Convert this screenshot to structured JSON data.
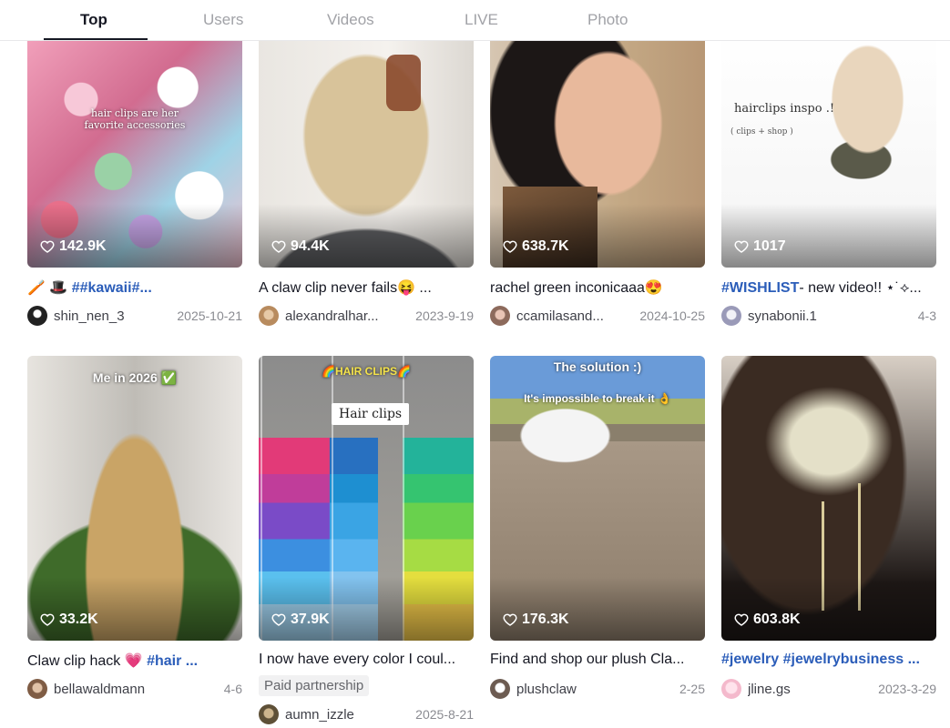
{
  "tabs": [
    "Top",
    "Users",
    "Videos",
    "LIVE",
    "Photo"
  ],
  "active_tab": "Top",
  "videos": [
    {
      "likes": "142.9K",
      "overlay": "hair clips are her favorite accessories",
      "caption_prefix": "🪥 🎩 ",
      "caption_tag": "##kawaii#...",
      "caption_text": "",
      "username": "shin_nen_3",
      "date": "2025-10-21"
    },
    {
      "likes": "94.4K",
      "caption_prefix": "",
      "caption_tag": "",
      "caption_text": "A claw clip never fails😝 ...",
      "username": "alexandralhar...",
      "date": "2023-9-19"
    },
    {
      "likes": "638.7K",
      "caption_prefix": "",
      "caption_tag": "",
      "caption_text": "rachel green inconicaaa😍",
      "username": "ccamilasand...",
      "date": "2024-10-25"
    },
    {
      "likes": "1017",
      "overlay": "hairclips inspo .!",
      "overlay_sub": "( clips + shop )",
      "caption_prefix": "",
      "caption_tag": "#WISHLIST",
      "caption_text": "- new video!! ⋆˙⟡...",
      "username": "synabonii.1",
      "date": "4-3"
    },
    {
      "likes": "33.2K",
      "overlay": "Me in 2026 ✅",
      "caption_prefix": "",
      "caption_text": "Claw clip hack 💗 ",
      "caption_tag": "#hair ...",
      "username": "bellawaldmann",
      "date": "4-6"
    },
    {
      "likes": "37.9K",
      "overlay": "🌈HAIR CLIPS🌈",
      "overlay_label": "Hair clips",
      "caption_prefix": "",
      "caption_tag": "",
      "caption_text": "I now have every color I coul...",
      "paid": "Paid partnership",
      "username": "aumn_izzle",
      "date": "2025-8-21"
    },
    {
      "likes": "176.3K",
      "overlay": "The solution :)",
      "overlay_sub": "It's impossible to break it 👌",
      "caption_prefix": "",
      "caption_tag": "",
      "caption_text": "Find and shop our plush Cla...",
      "username": "plushclaw",
      "date": "2-25"
    },
    {
      "likes": "603.8K",
      "caption_prefix": "",
      "caption_tag": "#jewelry #jewelrybusiness ...",
      "caption_text": "",
      "username": "jline.gs",
      "date": "2023-3-29"
    }
  ],
  "colors": {
    "text_primary": "#161823",
    "tab_inactive": "#a1a2a7",
    "hashtag": "#2b5db9",
    "date": "#8a8b91"
  }
}
